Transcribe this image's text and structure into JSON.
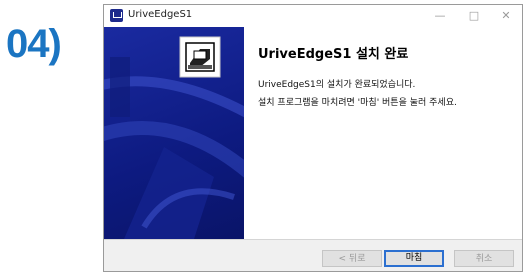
{
  "step_label": "04)",
  "window": {
    "title": "UriveEdgeS1",
    "controls": {
      "minimize": "—",
      "maximize": "□",
      "close": "✕"
    }
  },
  "content": {
    "heading": "UriveEdgeS1 설치 완료",
    "line1": "UriveEdgeS1의 설치가 완료되었습니다.",
    "line2": "설치 프로그램을 마치려면 '마침' 버튼을 눌러 주세요."
  },
  "buttons": {
    "back": "< 뒤로",
    "finish": "마침",
    "cancel": "취소"
  },
  "colors": {
    "step_label": "#1b75c2",
    "side_panel": "#1a2aa0",
    "default_button_border": "#2b6fd0"
  },
  "icons": [
    "app-icon",
    "installer-icon",
    "minimize-icon",
    "maximize-icon",
    "close-icon"
  ]
}
